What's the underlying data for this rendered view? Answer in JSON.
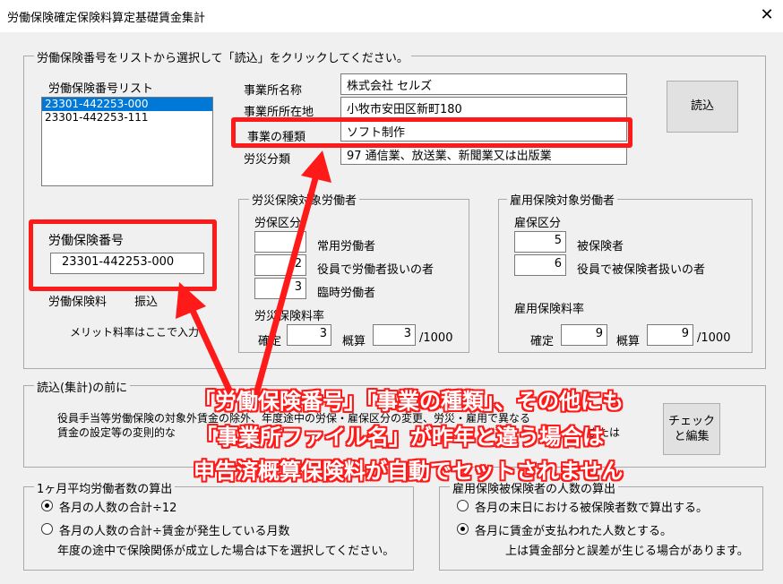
{
  "window": {
    "title": "労働保険確定保険料算定基礎賃金集計",
    "close_glyph": "✕"
  },
  "top_group": {
    "legend": "労働保険番号をリストから選択して「読込」をクリックしてください。",
    "list_label": "労働保険番号リスト",
    "list_items": [
      "23301-442253-000",
      "23301-442253-111"
    ],
    "fields": {
      "name_label": "事業所名称",
      "name_value": "株式会社 セルズ",
      "address_label": "事業所所在地",
      "address_value": "小牧市安田区新町180",
      "type_label": "事業の種類",
      "type_value": "ソフト制作",
      "rosai_label": "労災分類",
      "rosai_value": "97 通信業、放送業、新聞業又は出版業"
    },
    "read_button": "読込",
    "insurance_number_label": "労働保険番号",
    "insurance_number_value": "23301-442253-000",
    "premium_label": "労働保険料",
    "transfer_label": "振込",
    "merit_note": "メリット料率はここで入力",
    "rosai_group": {
      "legend": "労災保険対象労働者",
      "kubun_label": "労保区分",
      "rows": [
        {
          "value": "",
          "label": "常用労働者"
        },
        {
          "value": "2",
          "label": "役員で労働者扱いの者"
        },
        {
          "value": "3",
          "label": "臨時労働者"
        }
      ],
      "rate_label": "労災保険料率",
      "kakutei_label": "確定",
      "kakutei_value": "3",
      "gaisan_label": "概算",
      "gaisan_value": "3",
      "unit": "/1000"
    },
    "koyo_group": {
      "legend": "雇用保険対象労働者",
      "kubun_label": "雇保区分",
      "rows": [
        {
          "value": "5",
          "label": "被保険者"
        },
        {
          "value": "6",
          "label": "役員で被保険者扱いの者"
        }
      ],
      "rate_label": "雇用保険料率",
      "kakutei_label": "確定",
      "kakutei_value": "9",
      "gaisan_label": "概算",
      "gaisan_value": "9",
      "unit": "/1000"
    }
  },
  "before_read_group": {
    "legend": "読込(集計)の前に",
    "line1": "役員手当等労働保険の対象外賃金の除外、年度途中の労保・雇保区分の変更、労災・雇用で異なる",
    "line2": "賃金の設定等の変則的な",
    "line2_tail": "または",
    "check_button_line1": "チェック",
    "check_button_line2": "と編集"
  },
  "monthly_avg_group": {
    "legend": "1ヶ月平均労働者数の算出",
    "options": [
      "各月の人数の合計÷12",
      "各月の人数の合計÷賃金が発生している月数"
    ],
    "selected_index": 0,
    "note": "年度の途中で保険関係が成立した場合は下を選択してください。"
  },
  "koyo_count_group": {
    "legend": "雇用保険被保険者の人数の算出",
    "options": [
      "各月の末日における被保険者数で算出する。",
      "各月に賃金が支払われた人数とする。"
    ],
    "selected_index": 1,
    "note": "上は賃金部分と誤差が生じる場合があります。"
  },
  "annotation": {
    "line1": "「労働保険番号」「事業の種類」、その他にも",
    "line2": "「事業所ファイル名」が昨年と違う場合は",
    "line3": "申告済概算保険料が自動でセットされません",
    "color": "#ff1a1a"
  }
}
